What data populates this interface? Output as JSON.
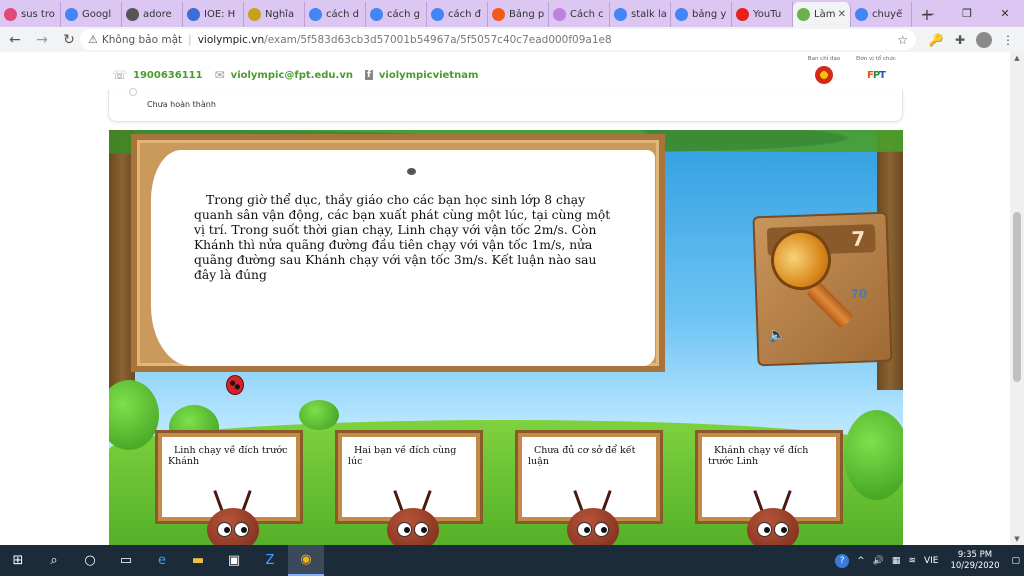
{
  "tabs": [
    {
      "title": "sus tro",
      "icon": "rainbow-icon",
      "color": "#e04a7a"
    },
    {
      "title": "Googl",
      "icon": "translate-icon",
      "color": "#4285f4"
    },
    {
      "title": "adore",
      "icon": "box-icon",
      "color": "#555555"
    },
    {
      "title": "IOE: H",
      "icon": "globe-icon",
      "color": "#3a6fd8"
    },
    {
      "title": "Nghĩa",
      "icon": "n-icon",
      "color": "#c8a020"
    },
    {
      "title": "cách d",
      "icon": "google-icon",
      "color": "#4285f4"
    },
    {
      "title": "cách g",
      "icon": "google-icon",
      "color": "#4285f4"
    },
    {
      "title": "cách đ",
      "icon": "google-icon",
      "color": "#4285f4"
    },
    {
      "title": "Bảng p",
      "icon": "orange-icon",
      "color": "#f05a1a"
    },
    {
      "title": "Cách c",
      "icon": "doc-icon",
      "color": "#c080e0"
    },
    {
      "title": "stalk la",
      "icon": "google-icon",
      "color": "#4285f4"
    },
    {
      "title": "bảng y",
      "icon": "google-icon",
      "color": "#4285f4"
    },
    {
      "title": "YouTu",
      "icon": "youtube-icon",
      "color": "#e62117"
    },
    {
      "title": "Làm",
      "icon": "violympic-icon",
      "color": "#6ab04c",
      "active": true
    },
    {
      "title": "chuyể",
      "icon": "google-icon",
      "color": "#4285f4"
    }
  ],
  "newtab_label": "+",
  "window": {
    "minimize": "—",
    "restore": "❐",
    "close": "✕"
  },
  "address": {
    "security": "Không bảo mật",
    "separator": "|",
    "host": "violympic.vn",
    "path": "/exam/5f583d63cb3d57001b54967a/5f5057c40c7ead000f09a1e8"
  },
  "contact": {
    "phone": "1900636111",
    "email": "violympic@fpt.edu.vn",
    "facebook": "violympicvietnam"
  },
  "sponsors": [
    {
      "label": "Ban chỉ đạo",
      "logo": "emblem-icon"
    },
    {
      "label": "Đơn vị tổ chức",
      "logo": "fpt-logo"
    }
  ],
  "status_text": "Chưa hoàn thành",
  "question": "Trong giờ thể dục, thầy giáo cho các bạn học sinh lớp 8 chạy quanh sân vận động, các bạn xuất phát cùng một lúc, tại cùng một vị trí. Trong suốt thời gian chạy, Linh chạy với vận tốc 2m/s. Còn Khánh thì nửa quãng đường đầu tiên chạy với vận tốc 1m/s, nửa quãng đường sau Khánh chạy với vận tốc 3m/s. Kết luận nào sau đây là đúng",
  "score": {
    "top": "7",
    "mid": "70"
  },
  "answers": [
    "Linh chạy về đích trước Khánh",
    "Hai bạn về đích cùng lúc",
    "Chưa đủ cơ sở để kết luận",
    "Khánh chạy về đích trước Linh"
  ],
  "taskbar": {
    "time": "9:35 PM",
    "date": "10/29/2020",
    "lang": "VIE"
  }
}
